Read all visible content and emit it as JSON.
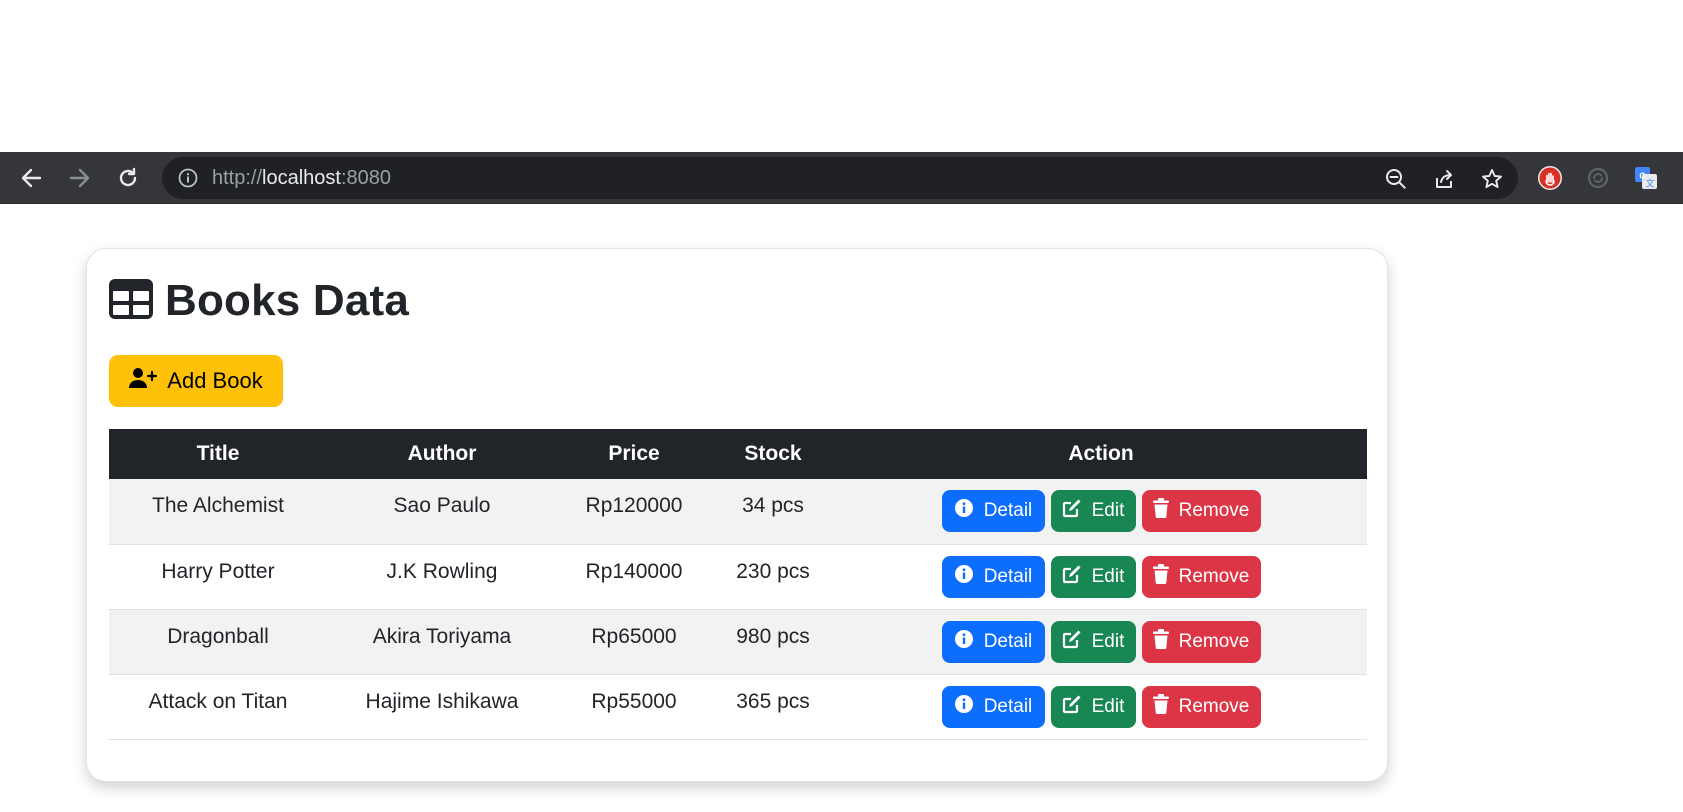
{
  "browser": {
    "url_scheme": "http://",
    "url_host": "localhost",
    "url_port": ":8080",
    "icons": {
      "back": "arrow-left-icon",
      "forward": "arrow-right-icon",
      "reload": "reload-icon",
      "site_info": "info-icon",
      "zoom": "zoom-out-icon",
      "share": "share-icon",
      "bookmark": "star-icon"
    },
    "colors": {
      "toolbar": "#35363a",
      "omnibox": "#202124"
    }
  },
  "page": {
    "title": "Books Data",
    "title_icon": "table-icon",
    "add_button_label": "Add Book",
    "add_button_icon": "user-plus-icon",
    "colors": {
      "warning": "#ffc107",
      "primary": "#0d6efd",
      "success": "#198754",
      "danger": "#dc3545",
      "table_header": "#212529"
    }
  },
  "table": {
    "headers": [
      "Title",
      "Author",
      "Price",
      "Stock",
      "Action"
    ],
    "action_labels": {
      "detail": "Detail",
      "edit": "Edit",
      "remove": "Remove"
    },
    "rows": [
      {
        "title": "The Alchemist",
        "author": "Sao Paulo",
        "price": "Rp120000",
        "stock": "34 pcs"
      },
      {
        "title": "Harry Potter",
        "author": "J.K Rowling",
        "price": "Rp140000",
        "stock": "230 pcs"
      },
      {
        "title": "Dragonball",
        "author": "Akira Toriyama",
        "price": "Rp65000",
        "stock": "980 pcs"
      },
      {
        "title": "Attack on Titan",
        "author": "Hajime Ishikawa",
        "price": "Rp55000",
        "stock": "365 pcs"
      }
    ]
  }
}
